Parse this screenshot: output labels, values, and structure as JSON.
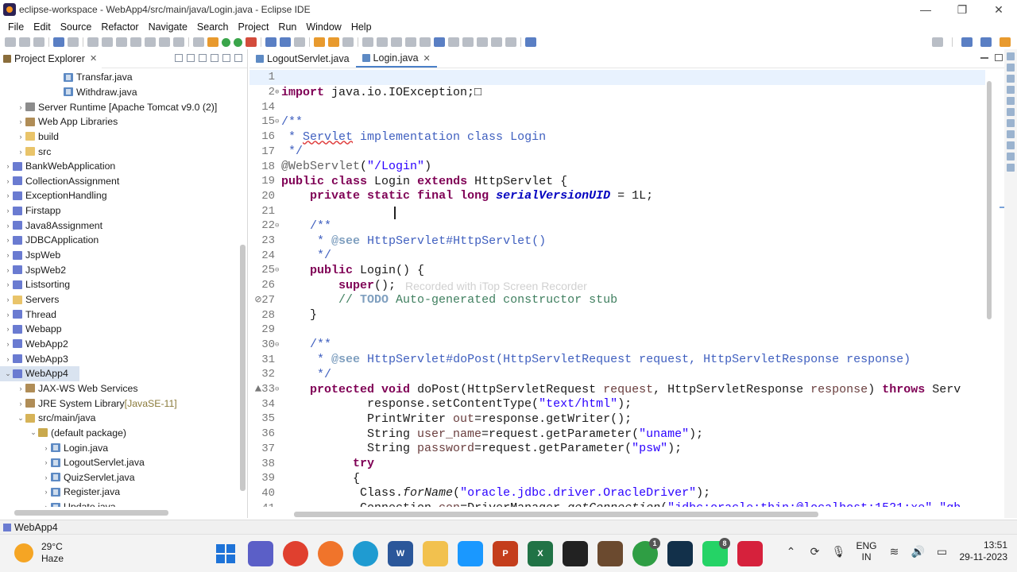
{
  "window": {
    "title": "eclipse-workspace - WebApp4/src/main/java/Login.java - Eclipse IDE",
    "controls": {
      "minimize": "—",
      "restore": "❐",
      "close": "✕"
    }
  },
  "menu": [
    "File",
    "Edit",
    "Source",
    "Refactor",
    "Navigate",
    "Search",
    "Project",
    "Run",
    "Window",
    "Help"
  ],
  "explorer": {
    "tab_label": "Project Explorer",
    "close": "✕",
    "tree": [
      {
        "label": "Transfar.java",
        "indent": 4,
        "icon": "java",
        "arrow": ""
      },
      {
        "label": "Withdraw.java",
        "indent": 4,
        "icon": "java",
        "arrow": ""
      },
      {
        "label": "Server Runtime [Apache Tomcat v9.0 (2)]",
        "indent": 1,
        "icon": "server",
        "arrow": "›"
      },
      {
        "label": "Web App Libraries",
        "indent": 1,
        "icon": "lib",
        "arrow": "›"
      },
      {
        "label": "build",
        "indent": 1,
        "icon": "folder",
        "arrow": "›"
      },
      {
        "label": "src",
        "indent": 1,
        "icon": "folder",
        "arrow": "›"
      },
      {
        "label": "BankWebApplication",
        "indent": 0,
        "icon": "project",
        "arrow": "›"
      },
      {
        "label": "CollectionAssignment",
        "indent": 0,
        "icon": "project",
        "arrow": "›"
      },
      {
        "label": "ExceptionHandling",
        "indent": 0,
        "icon": "project",
        "arrow": "›"
      },
      {
        "label": "Firstapp",
        "indent": 0,
        "icon": "project",
        "arrow": "›"
      },
      {
        "label": "Java8Assignment",
        "indent": 0,
        "icon": "project",
        "arrow": "›"
      },
      {
        "label": "JDBCApplication",
        "indent": 0,
        "icon": "project",
        "arrow": "›"
      },
      {
        "label": "JspWeb",
        "indent": 0,
        "icon": "project",
        "arrow": "›"
      },
      {
        "label": "JspWeb2",
        "indent": 0,
        "icon": "project",
        "arrow": "›"
      },
      {
        "label": "Listsorting",
        "indent": 0,
        "icon": "project",
        "arrow": "›"
      },
      {
        "label": "Servers",
        "indent": 0,
        "icon": "folder",
        "arrow": "›"
      },
      {
        "label": "Thread",
        "indent": 0,
        "icon": "project",
        "arrow": "›"
      },
      {
        "label": "Webapp",
        "indent": 0,
        "icon": "project",
        "arrow": "›"
      },
      {
        "label": "WebApp2",
        "indent": 0,
        "icon": "project",
        "arrow": "›"
      },
      {
        "label": "WebApp3",
        "indent": 0,
        "icon": "project",
        "arrow": "›"
      },
      {
        "label": "WebApp4",
        "indent": 0,
        "icon": "project",
        "arrow": "⌄",
        "selected": true
      },
      {
        "label": "JAX-WS Web Services",
        "indent": 1,
        "icon": "lib",
        "arrow": "›"
      },
      {
        "label": "JRE System Library",
        "suffix": "[JavaSE-11]",
        "indent": 1,
        "icon": "lib",
        "arrow": "›"
      },
      {
        "label": "src/main/java",
        "indent": 1,
        "icon": "src",
        "arrow": "⌄"
      },
      {
        "label": "(default package)",
        "indent": 2,
        "icon": "pkg",
        "arrow": "⌄"
      },
      {
        "label": "Login.java",
        "indent": 3,
        "icon": "java",
        "arrow": "›"
      },
      {
        "label": "LogoutServlet.java",
        "indent": 3,
        "icon": "java",
        "arrow": "›"
      },
      {
        "label": "QuizServlet.java",
        "indent": 3,
        "icon": "java",
        "arrow": "›"
      },
      {
        "label": "Register.java",
        "indent": 3,
        "icon": "java",
        "arrow": "›"
      },
      {
        "label": "Update.java",
        "indent": 3,
        "icon": "java",
        "arrow": "›"
      }
    ]
  },
  "editor": {
    "tabs": [
      {
        "label": "LogoutServlet.java",
        "active": false
      },
      {
        "label": "Login.java",
        "active": true,
        "close": "✕"
      }
    ],
    "watermark": "Recorded with iTop Screen Recorder",
    "lines": [
      {
        "n": "1",
        "fold": "",
        "cur": true,
        "tokens": []
      },
      {
        "n": "2",
        "fold": "+",
        "tokens": [
          [
            "kw",
            "import"
          ],
          [
            "txt",
            " java.io.IOException;"
          ],
          [
            "txt",
            "□"
          ]
        ]
      },
      {
        "n": "14",
        "fold": "",
        "tokens": []
      },
      {
        "n": "15",
        "fold": "-",
        "tokens": [
          [
            "jd",
            "/**"
          ]
        ]
      },
      {
        "n": "16",
        "fold": "",
        "tokens": [
          [
            "jd",
            " * "
          ],
          [
            "jdu",
            "Servlet"
          ],
          [
            "jd",
            " implementation class Login"
          ]
        ]
      },
      {
        "n": "17",
        "fold": "",
        "tokens": [
          [
            "jd",
            " */"
          ]
        ]
      },
      {
        "n": "18",
        "fold": "",
        "tokens": [
          [
            "ann",
            "@WebServlet"
          ],
          [
            "txt",
            "("
          ],
          [
            "str",
            "\"/Login\""
          ],
          [
            "txt",
            ")"
          ]
        ]
      },
      {
        "n": "19",
        "fold": "",
        "tokens": [
          [
            "kw",
            "public"
          ],
          [
            "txt",
            " "
          ],
          [
            "kw",
            "class"
          ],
          [
            "txt",
            " Login "
          ],
          [
            "kw",
            "extends"
          ],
          [
            "txt",
            " HttpServlet {"
          ]
        ]
      },
      {
        "n": "20",
        "fold": "",
        "tokens": [
          [
            "txt",
            "    "
          ],
          [
            "kw",
            "private"
          ],
          [
            "txt",
            " "
          ],
          [
            "kw",
            "static"
          ],
          [
            "txt",
            " "
          ],
          [
            "kw",
            "final"
          ],
          [
            "txt",
            " "
          ],
          [
            "kw",
            "long"
          ],
          [
            "txt",
            " "
          ],
          [
            "field",
            "serialVersionUID"
          ],
          [
            "txt",
            " = 1L;"
          ]
        ]
      },
      {
        "n": "21",
        "fold": "",
        "tokens": []
      },
      {
        "n": "22",
        "fold": "-",
        "tokens": [
          [
            "txt",
            "    "
          ],
          [
            "jd",
            "/**"
          ]
        ]
      },
      {
        "n": "23",
        "fold": "",
        "tokens": [
          [
            "txt",
            "    "
          ],
          [
            "jd",
            " * "
          ],
          [
            "jdtag",
            "@see"
          ],
          [
            "jd",
            " HttpServlet#HttpServlet()"
          ]
        ]
      },
      {
        "n": "24",
        "fold": "",
        "tokens": [
          [
            "txt",
            "    "
          ],
          [
            "jd",
            " */"
          ]
        ]
      },
      {
        "n": "25",
        "fold": "-",
        "tokens": [
          [
            "txt",
            "    "
          ],
          [
            "kw",
            "public"
          ],
          [
            "txt",
            " Login() {"
          ]
        ]
      },
      {
        "n": "26",
        "fold": "",
        "tokens": [
          [
            "txt",
            "        "
          ],
          [
            "kw",
            "super"
          ],
          [
            "txt",
            "();"
          ]
        ]
      },
      {
        "n": "27",
        "fold": "",
        "marker": "⊘",
        "tokens": [
          [
            "txt",
            "        "
          ],
          [
            "cm",
            "// "
          ],
          [
            "todo",
            "TODO"
          ],
          [
            "cm",
            " Auto-generated constructor stub"
          ]
        ]
      },
      {
        "n": "28",
        "fold": "",
        "tokens": [
          [
            "txt",
            "    }"
          ]
        ]
      },
      {
        "n": "29",
        "fold": "",
        "tokens": []
      },
      {
        "n": "30",
        "fold": "-",
        "tokens": [
          [
            "txt",
            "    "
          ],
          [
            "jd",
            "/**"
          ]
        ]
      },
      {
        "n": "31",
        "fold": "",
        "tokens": [
          [
            "txt",
            "    "
          ],
          [
            "jd",
            " * "
          ],
          [
            "jdtag",
            "@see"
          ],
          [
            "jd",
            " HttpServlet#doPost(HttpServletRequest request, HttpServletResponse response)"
          ]
        ]
      },
      {
        "n": "32",
        "fold": "",
        "tokens": [
          [
            "txt",
            "    "
          ],
          [
            "jd",
            " */"
          ]
        ]
      },
      {
        "n": "33",
        "fold": "-",
        "marker": "▲",
        "tokens": [
          [
            "txt",
            "    "
          ],
          [
            "kw",
            "protected"
          ],
          [
            "txt",
            " "
          ],
          [
            "kw",
            "void"
          ],
          [
            "txt",
            " doPost(HttpServletRequest "
          ],
          [
            "param",
            "request"
          ],
          [
            "txt",
            ", HttpServletResponse "
          ],
          [
            "param",
            "response"
          ],
          [
            "txt",
            ") "
          ],
          [
            "kw",
            "throws"
          ],
          [
            "txt",
            " Serv"
          ]
        ]
      },
      {
        "n": "34",
        "fold": "",
        "tokens": [
          [
            "txt",
            "            response.setContentType("
          ],
          [
            "str",
            "\"text/html\""
          ],
          [
            "txt",
            ");"
          ]
        ]
      },
      {
        "n": "35",
        "fold": "",
        "tokens": [
          [
            "txt",
            "            PrintWriter "
          ],
          [
            "param",
            "out"
          ],
          [
            "txt",
            "=response.getWriter();"
          ]
        ]
      },
      {
        "n": "36",
        "fold": "",
        "tokens": [
          [
            "txt",
            "            String "
          ],
          [
            "param",
            "user_name"
          ],
          [
            "txt",
            "=request.getParameter("
          ],
          [
            "str",
            "\"uname\""
          ],
          [
            "txt",
            ");"
          ]
        ]
      },
      {
        "n": "37",
        "fold": "",
        "tokens": [
          [
            "txt",
            "            String "
          ],
          [
            "param",
            "password"
          ],
          [
            "txt",
            "=request.getParameter("
          ],
          [
            "str",
            "\"psw\""
          ],
          [
            "txt",
            ");"
          ]
        ]
      },
      {
        "n": "38",
        "fold": "",
        "tokens": [
          [
            "txt",
            "          "
          ],
          [
            "kw",
            "try"
          ]
        ]
      },
      {
        "n": "39",
        "fold": "",
        "tokens": [
          [
            "txt",
            "          {"
          ]
        ]
      },
      {
        "n": "40",
        "fold": "",
        "tokens": [
          [
            "txt",
            "           Class."
          ],
          [
            "static",
            "forName"
          ],
          [
            "txt",
            "("
          ],
          [
            "str",
            "\"oracle.jdbc.driver.OracleDriver\""
          ],
          [
            "txt",
            ");"
          ]
        ]
      },
      {
        "n": "41",
        "fold": "",
        "tokens": [
          [
            "txt",
            "           Connection "
          ],
          [
            "param",
            "con"
          ],
          [
            "txt",
            "=DriverManager."
          ],
          [
            "static",
            "getConnection"
          ],
          [
            "txt",
            "("
          ],
          [
            "str",
            "\"jdbc:oracle:thin:@localhost:1521:xe\""
          ],
          [
            "txt",
            ","
          ],
          [
            "str",
            "\"gh"
          ]
        ]
      }
    ]
  },
  "statusbar": {
    "label": "WebApp4"
  },
  "taskbar": {
    "weather": {
      "temp": "29°C",
      "condition": "Haze"
    },
    "apps": [
      {
        "name": "windows-start",
        "color": "#1e73d8",
        "label": ""
      },
      {
        "name": "teams",
        "color": "#5b5fc7",
        "label": ""
      },
      {
        "name": "chrome",
        "color": "#e0402f",
        "label": ""
      },
      {
        "name": "firefox",
        "color": "#f0742b",
        "label": ""
      },
      {
        "name": "edge",
        "color": "#1f9bd1",
        "label": ""
      },
      {
        "name": "word",
        "color": "#2b579a",
        "label": "W"
      },
      {
        "name": "file-explorer",
        "color": "#f2c14e",
        "label": ""
      },
      {
        "name": "prime-video",
        "color": "#1a98ff",
        "label": ""
      },
      {
        "name": "powerpoint",
        "color": "#c43e1c",
        "label": "P"
      },
      {
        "name": "excel",
        "color": "#217346",
        "label": "X"
      },
      {
        "name": "terminal",
        "color": "#222222",
        "label": ""
      },
      {
        "name": "eclipse",
        "color": "#6b4a2f",
        "label": ""
      },
      {
        "name": "chrome-profile",
        "color": "#2f9e44",
        "label": "",
        "badge": "1"
      },
      {
        "name": "mysql",
        "color": "#12304a",
        "label": ""
      },
      {
        "name": "whatsapp",
        "color": "#25d366",
        "label": "",
        "badge": "8"
      },
      {
        "name": "screen-recorder",
        "color": "#d6213c",
        "label": ""
      }
    ],
    "tray": {
      "lang_1": "ENG",
      "lang_2": "IN",
      "time": "13:51",
      "date": "29-11-2023"
    }
  }
}
